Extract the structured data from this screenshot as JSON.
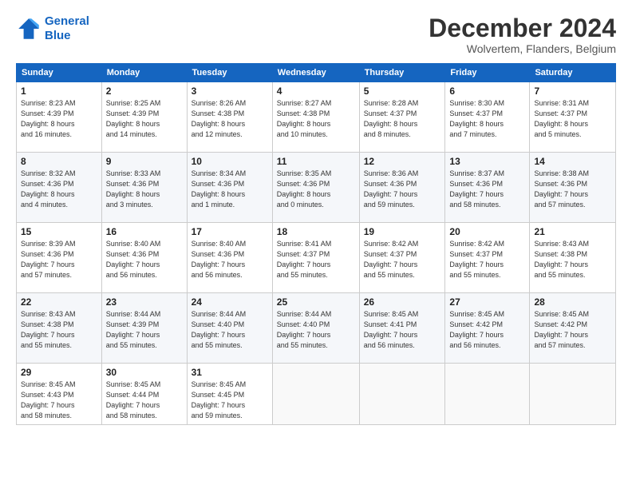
{
  "logo": {
    "line1": "General",
    "line2": "Blue"
  },
  "title": "December 2024",
  "subtitle": "Wolvertem, Flanders, Belgium",
  "days_of_week": [
    "Sunday",
    "Monday",
    "Tuesday",
    "Wednesday",
    "Thursday",
    "Friday",
    "Saturday"
  ],
  "weeks": [
    [
      {
        "day": "1",
        "info": "Sunrise: 8:23 AM\nSunset: 4:39 PM\nDaylight: 8 hours\nand 16 minutes."
      },
      {
        "day": "2",
        "info": "Sunrise: 8:25 AM\nSunset: 4:39 PM\nDaylight: 8 hours\nand 14 minutes."
      },
      {
        "day": "3",
        "info": "Sunrise: 8:26 AM\nSunset: 4:38 PM\nDaylight: 8 hours\nand 12 minutes."
      },
      {
        "day": "4",
        "info": "Sunrise: 8:27 AM\nSunset: 4:38 PM\nDaylight: 8 hours\nand 10 minutes."
      },
      {
        "day": "5",
        "info": "Sunrise: 8:28 AM\nSunset: 4:37 PM\nDaylight: 8 hours\nand 8 minutes."
      },
      {
        "day": "6",
        "info": "Sunrise: 8:30 AM\nSunset: 4:37 PM\nDaylight: 8 hours\nand 7 minutes."
      },
      {
        "day": "7",
        "info": "Sunrise: 8:31 AM\nSunset: 4:37 PM\nDaylight: 8 hours\nand 5 minutes."
      }
    ],
    [
      {
        "day": "8",
        "info": "Sunrise: 8:32 AM\nSunset: 4:36 PM\nDaylight: 8 hours\nand 4 minutes."
      },
      {
        "day": "9",
        "info": "Sunrise: 8:33 AM\nSunset: 4:36 PM\nDaylight: 8 hours\nand 3 minutes."
      },
      {
        "day": "10",
        "info": "Sunrise: 8:34 AM\nSunset: 4:36 PM\nDaylight: 8 hours\nand 1 minute."
      },
      {
        "day": "11",
        "info": "Sunrise: 8:35 AM\nSunset: 4:36 PM\nDaylight: 8 hours\nand 0 minutes."
      },
      {
        "day": "12",
        "info": "Sunrise: 8:36 AM\nSunset: 4:36 PM\nDaylight: 7 hours\nand 59 minutes."
      },
      {
        "day": "13",
        "info": "Sunrise: 8:37 AM\nSunset: 4:36 PM\nDaylight: 7 hours\nand 58 minutes."
      },
      {
        "day": "14",
        "info": "Sunrise: 8:38 AM\nSunset: 4:36 PM\nDaylight: 7 hours\nand 57 minutes."
      }
    ],
    [
      {
        "day": "15",
        "info": "Sunrise: 8:39 AM\nSunset: 4:36 PM\nDaylight: 7 hours\nand 57 minutes."
      },
      {
        "day": "16",
        "info": "Sunrise: 8:40 AM\nSunset: 4:36 PM\nDaylight: 7 hours\nand 56 minutes."
      },
      {
        "day": "17",
        "info": "Sunrise: 8:40 AM\nSunset: 4:36 PM\nDaylight: 7 hours\nand 56 minutes."
      },
      {
        "day": "18",
        "info": "Sunrise: 8:41 AM\nSunset: 4:37 PM\nDaylight: 7 hours\nand 55 minutes."
      },
      {
        "day": "19",
        "info": "Sunrise: 8:42 AM\nSunset: 4:37 PM\nDaylight: 7 hours\nand 55 minutes."
      },
      {
        "day": "20",
        "info": "Sunrise: 8:42 AM\nSunset: 4:37 PM\nDaylight: 7 hours\nand 55 minutes."
      },
      {
        "day": "21",
        "info": "Sunrise: 8:43 AM\nSunset: 4:38 PM\nDaylight: 7 hours\nand 55 minutes."
      }
    ],
    [
      {
        "day": "22",
        "info": "Sunrise: 8:43 AM\nSunset: 4:38 PM\nDaylight: 7 hours\nand 55 minutes."
      },
      {
        "day": "23",
        "info": "Sunrise: 8:44 AM\nSunset: 4:39 PM\nDaylight: 7 hours\nand 55 minutes."
      },
      {
        "day": "24",
        "info": "Sunrise: 8:44 AM\nSunset: 4:40 PM\nDaylight: 7 hours\nand 55 minutes."
      },
      {
        "day": "25",
        "info": "Sunrise: 8:44 AM\nSunset: 4:40 PM\nDaylight: 7 hours\nand 55 minutes."
      },
      {
        "day": "26",
        "info": "Sunrise: 8:45 AM\nSunset: 4:41 PM\nDaylight: 7 hours\nand 56 minutes."
      },
      {
        "day": "27",
        "info": "Sunrise: 8:45 AM\nSunset: 4:42 PM\nDaylight: 7 hours\nand 56 minutes."
      },
      {
        "day": "28",
        "info": "Sunrise: 8:45 AM\nSunset: 4:42 PM\nDaylight: 7 hours\nand 57 minutes."
      }
    ],
    [
      {
        "day": "29",
        "info": "Sunrise: 8:45 AM\nSunset: 4:43 PM\nDaylight: 7 hours\nand 58 minutes."
      },
      {
        "day": "30",
        "info": "Sunrise: 8:45 AM\nSunset: 4:44 PM\nDaylight: 7 hours\nand 58 minutes."
      },
      {
        "day": "31",
        "info": "Sunrise: 8:45 AM\nSunset: 4:45 PM\nDaylight: 7 hours\nand 59 minutes."
      },
      {
        "day": "",
        "info": ""
      },
      {
        "day": "",
        "info": ""
      },
      {
        "day": "",
        "info": ""
      },
      {
        "day": "",
        "info": ""
      }
    ]
  ]
}
